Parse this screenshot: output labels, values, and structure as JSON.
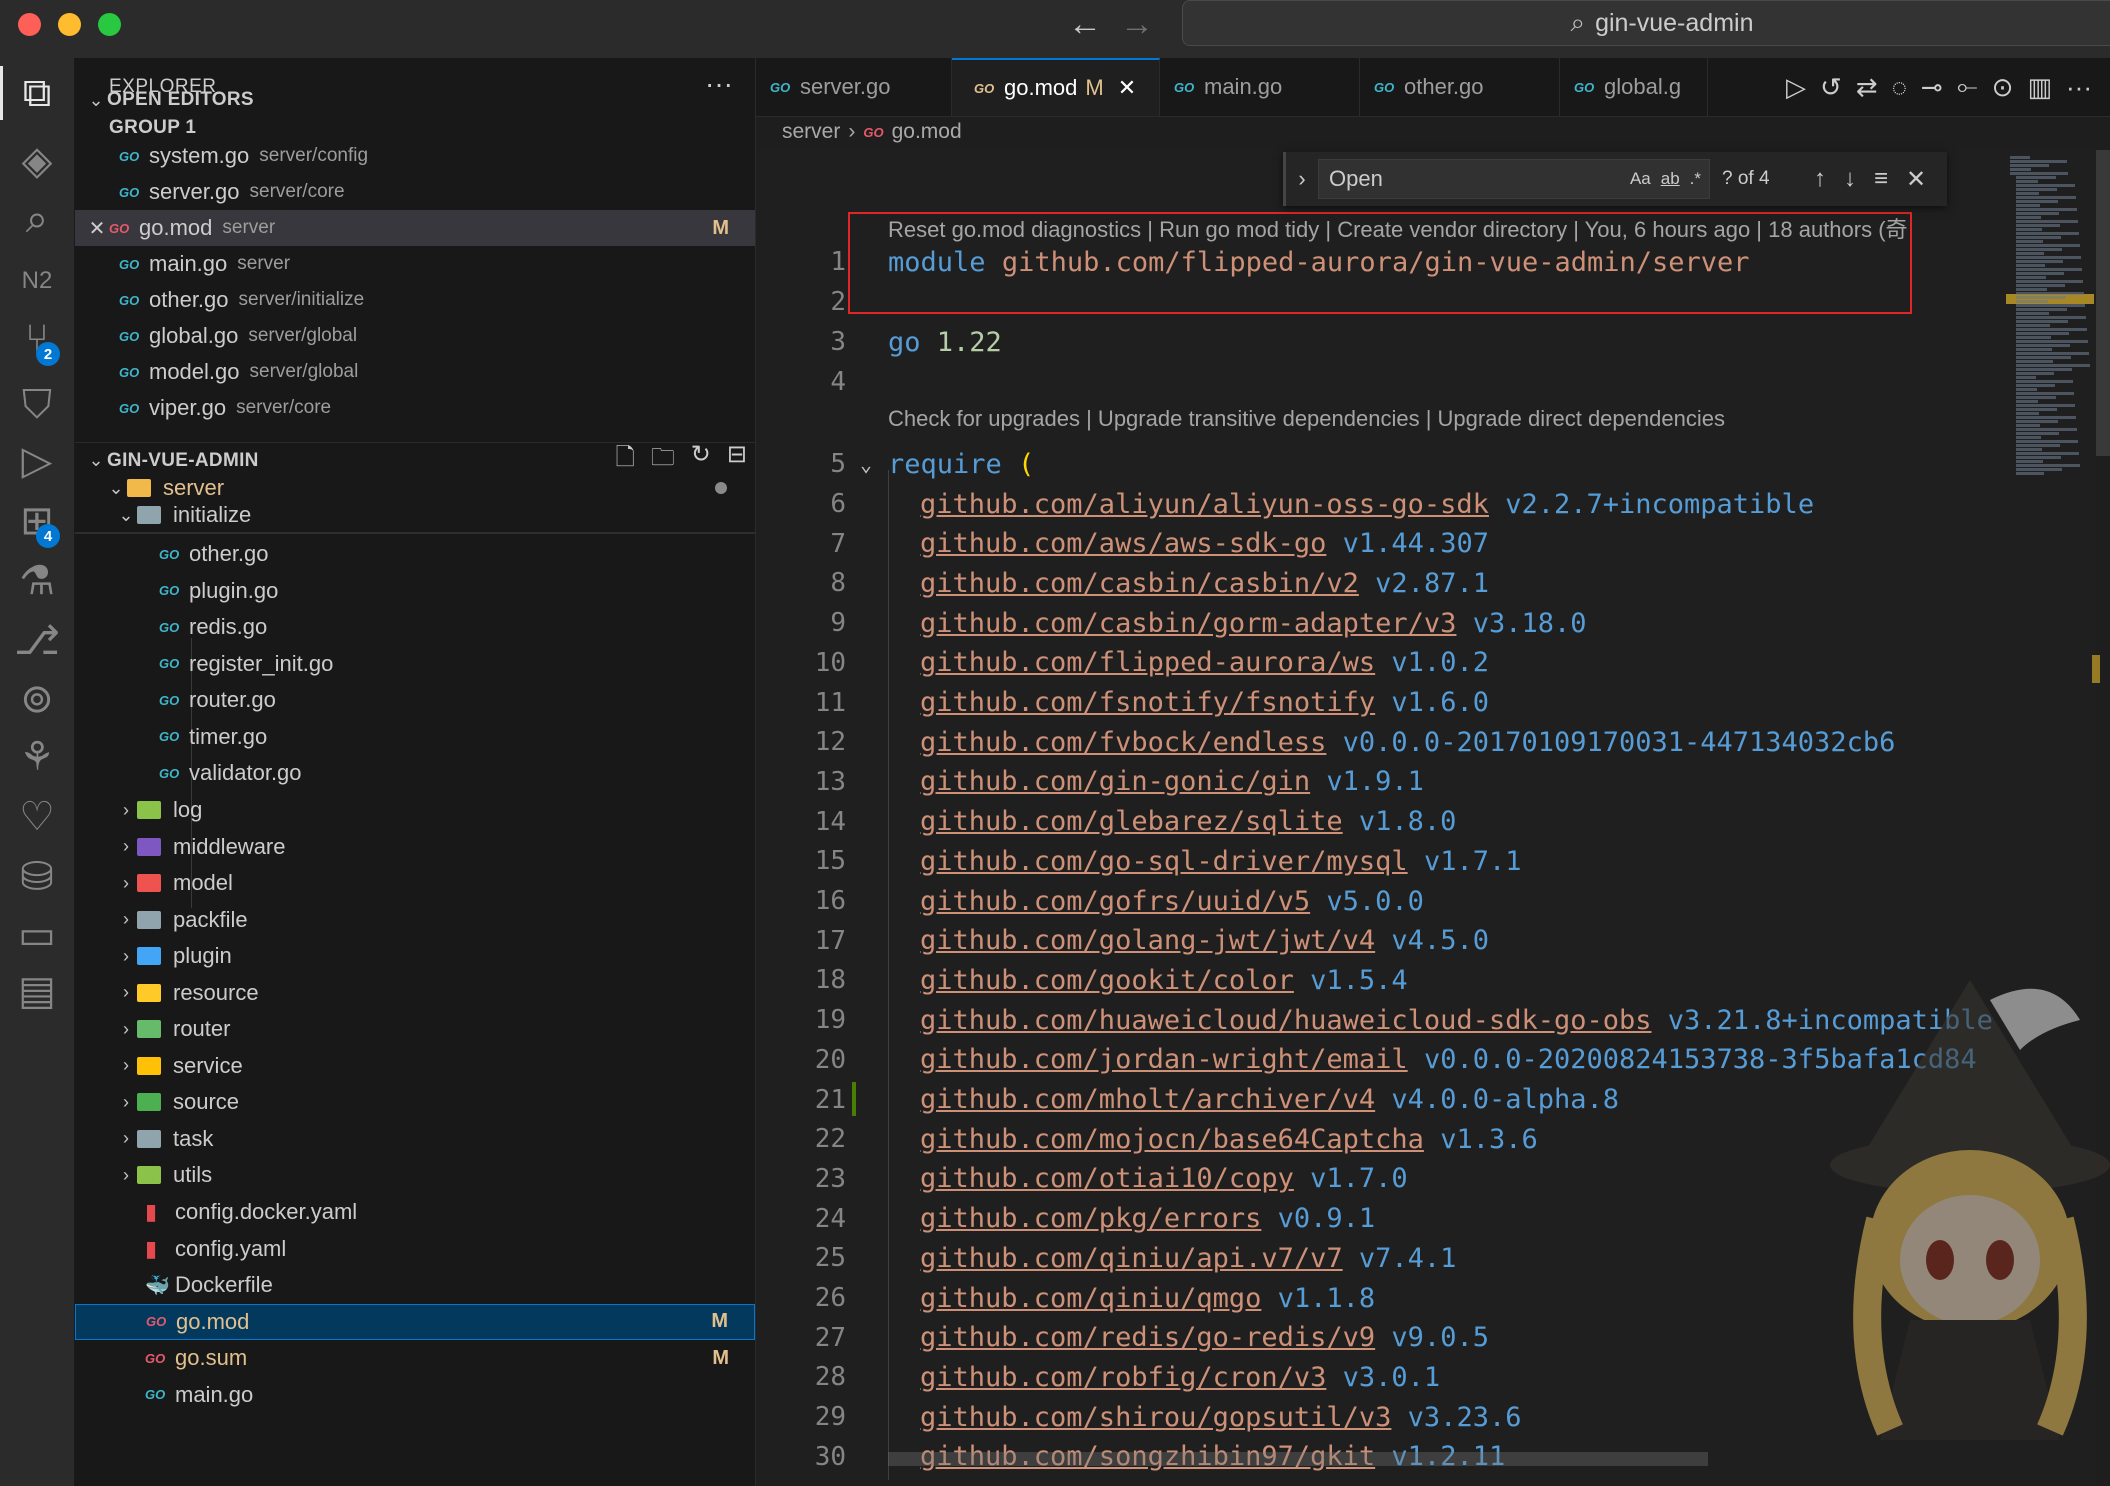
{
  "window": {
    "title": "gin-vue-admin"
  },
  "activity_bar": {
    "items": [
      {
        "name": "explorer-icon",
        "glyph": "⧉"
      },
      {
        "name": "ethereum-icon",
        "glyph": "◈"
      },
      {
        "name": "search-icon",
        "glyph": "⌕"
      },
      {
        "name": "n2-icon",
        "glyph": "N2"
      },
      {
        "name": "source-control-icon",
        "glyph": "⑂",
        "badge": "2"
      },
      {
        "name": "bookmark-icon",
        "glyph": "⛉"
      },
      {
        "name": "run-debug-icon",
        "glyph": "▷"
      },
      {
        "name": "extensions-icon",
        "glyph": "⊞",
        "badge": "4"
      },
      {
        "name": "testing-icon",
        "glyph": "⚗"
      },
      {
        "name": "git-graph-icon",
        "glyph": "⎇"
      },
      {
        "name": "remote-explorer-icon",
        "glyph": "⊚"
      },
      {
        "name": "tree-icon",
        "glyph": "⚘"
      },
      {
        "name": "heart-icon",
        "glyph": "♡"
      },
      {
        "name": "database-icon",
        "glyph": "⛁"
      },
      {
        "name": "comments-icon",
        "glyph": "▭"
      },
      {
        "name": "folders-icon",
        "glyph": "▤"
      }
    ]
  },
  "explorer": {
    "header": "EXPLORER",
    "open_editors": {
      "title": "OPEN EDITORS",
      "group": "GROUP 1",
      "files": [
        {
          "name": "system.go",
          "path": "server/config",
          "type": "go",
          "modified": ""
        },
        {
          "name": "server.go",
          "path": "server/core",
          "type": "go",
          "modified": ""
        },
        {
          "name": "go.mod",
          "path": "server",
          "type": "mod",
          "modified": "M"
        },
        {
          "name": "main.go",
          "path": "server",
          "type": "go",
          "modified": ""
        },
        {
          "name": "other.go",
          "path": "server/initialize",
          "type": "go",
          "modified": ""
        },
        {
          "name": "global.go",
          "path": "server/global",
          "type": "go",
          "modified": ""
        },
        {
          "name": "model.go",
          "path": "server/global",
          "type": "go",
          "modified": ""
        },
        {
          "name": "viper.go",
          "path": "server/core",
          "type": "go",
          "modified": ""
        }
      ]
    },
    "project": {
      "title": "GIN-VUE-ADMIN",
      "root": "server",
      "subfolder": "initialize",
      "initialize_files": [
        "other.go",
        "plugin.go",
        "redis.go",
        "register_init.go",
        "router.go",
        "timer.go",
        "validator.go"
      ],
      "folders": [
        {
          "name": "log",
          "color": "#8bc34a"
        },
        {
          "name": "middleware",
          "color": "#7e57c2"
        },
        {
          "name": "model",
          "color": "#ef5350"
        },
        {
          "name": "packfile",
          "color": "#90a4ae"
        },
        {
          "name": "plugin",
          "color": "#42a5f5"
        },
        {
          "name": "resource",
          "color": "#ffca28"
        },
        {
          "name": "router",
          "color": "#66bb6a"
        },
        {
          "name": "service",
          "color": "#ffc107"
        },
        {
          "name": "source",
          "color": "#4caf50"
        },
        {
          "name": "task",
          "color": "#90a4ae"
        },
        {
          "name": "utils",
          "color": "#8bc34a"
        }
      ],
      "files": [
        {
          "name": "config.docker.yaml",
          "type": "yaml",
          "modified": ""
        },
        {
          "name": "config.yaml",
          "type": "yaml",
          "modified": ""
        },
        {
          "name": "Dockerfile",
          "type": "docker",
          "modified": ""
        },
        {
          "name": "go.mod",
          "type": "mod",
          "modified": "M"
        },
        {
          "name": "go.sum",
          "type": "mod",
          "modified": "M"
        },
        {
          "name": "main.go",
          "type": "go",
          "modified": ""
        }
      ]
    }
  },
  "tabs": [
    {
      "label": "server.go",
      "active": false,
      "modified": ""
    },
    {
      "label": "go.mod",
      "active": true,
      "modified": "M"
    },
    {
      "label": "main.go",
      "active": false,
      "modified": ""
    },
    {
      "label": "other.go",
      "active": false,
      "modified": ""
    },
    {
      "label": "global.g",
      "active": false,
      "modified": ""
    }
  ],
  "breadcrumb": {
    "folder": "server",
    "file": "go.mod"
  },
  "find": {
    "query": "Open",
    "count": "? of 4",
    "opt_case": "Aa",
    "opt_word": "ab",
    "opt_regex": ".*"
  },
  "codelens": {
    "top": "Reset go.mod diagnostics | Run go mod tidy | Create vendor directory | You, 6 hours ago | 18 authors (奇",
    "require": "Check for upgrades | Upgrade transitive dependencies | Upgrade direct dependencies"
  },
  "code": {
    "module_line": {
      "num": "1",
      "keyword": "module",
      "path": "github.com/flipped-aurora/gin-vue-admin/server"
    },
    "go_line": {
      "num": "3",
      "keyword": "go",
      "version": "1.22"
    },
    "require_line": {
      "num": "5",
      "keyword": "require",
      "paren": "("
    },
    "empty_lines": [
      "2",
      "4"
    ],
    "requires": [
      {
        "num": "6",
        "path": "github.com/aliyun/aliyun-oss-go-sdk",
        "version": "v2.2.7+incompatible"
      },
      {
        "num": "7",
        "path": "github.com/aws/aws-sdk-go",
        "version": "v1.44.307"
      },
      {
        "num": "8",
        "path": "github.com/casbin/casbin/v2",
        "version": "v2.87.1"
      },
      {
        "num": "9",
        "path": "github.com/casbin/gorm-adapter/v3",
        "version": "v3.18.0"
      },
      {
        "num": "10",
        "path": "github.com/flipped-aurora/ws",
        "version": "v1.0.2"
      },
      {
        "num": "11",
        "path": "github.com/fsnotify/fsnotify",
        "version": "v1.6.0"
      },
      {
        "num": "12",
        "path": "github.com/fvbock/endless",
        "version": "v0.0.0-20170109170031-447134032cb6"
      },
      {
        "num": "13",
        "path": "github.com/gin-gonic/gin",
        "version": "v1.9.1"
      },
      {
        "num": "14",
        "path": "github.com/glebarez/sqlite",
        "version": "v1.8.0"
      },
      {
        "num": "15",
        "path": "github.com/go-sql-driver/mysql",
        "version": "v1.7.1"
      },
      {
        "num": "16",
        "path": "github.com/gofrs/uuid/v5",
        "version": "v5.0.0"
      },
      {
        "num": "17",
        "path": "github.com/golang-jwt/jwt/v4",
        "version": "v4.5.0"
      },
      {
        "num": "18",
        "path": "github.com/gookit/color",
        "version": "v1.5.4"
      },
      {
        "num": "19",
        "path": "github.com/huaweicloud/huaweicloud-sdk-go-obs",
        "version": "v3.21.8+incompatible"
      },
      {
        "num": "20",
        "path": "github.com/jordan-wright/email",
        "version": "v0.0.0-20200824153738-3f5bafa1cd84"
      },
      {
        "num": "21",
        "path": "github.com/mholt/archiver/v4",
        "version": "v4.0.0-alpha.8"
      },
      {
        "num": "22",
        "path": "github.com/mojocn/base64Captcha",
        "version": "v1.3.6"
      },
      {
        "num": "23",
        "path": "github.com/otiai10/copy",
        "version": "v1.7.0"
      },
      {
        "num": "24",
        "path": "github.com/pkg/errors",
        "version": "v0.9.1"
      },
      {
        "num": "25",
        "path": "github.com/qiniu/api.v7/v7",
        "version": "v7.4.1"
      },
      {
        "num": "26",
        "path": "github.com/qiniu/qmgo",
        "version": "v1.1.8"
      },
      {
        "num": "27",
        "path": "github.com/redis/go-redis/v9",
        "version": "v9.0.5"
      },
      {
        "num": "28",
        "path": "github.com/robfig/cron/v3",
        "version": "v3.0.1"
      },
      {
        "num": "29",
        "path": "github.com/shirou/gopsutil/v3",
        "version": "v3.23.6"
      },
      {
        "num": "30",
        "path": "github.com/songzhibin97/gkit",
        "version": "v1.2.11"
      }
    ]
  },
  "colors": {
    "accent": "#0078d4",
    "modified": "#e2c08d",
    "string": "#ce9178",
    "keyword": "#569cd6",
    "highlight_box": "#e02626"
  }
}
